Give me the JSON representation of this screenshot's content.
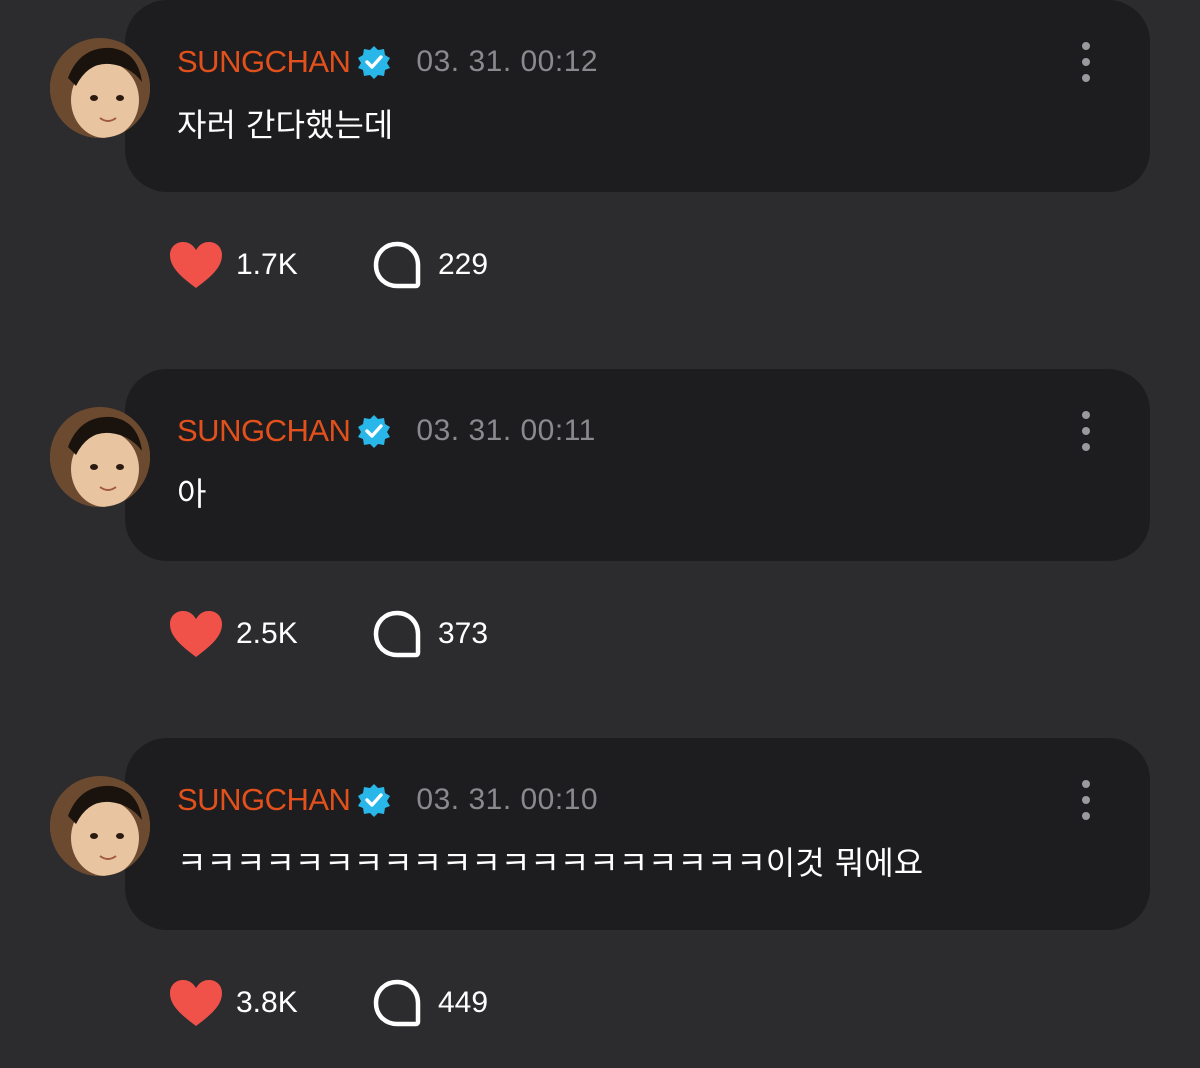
{
  "colors": {
    "background": "#2c2c2e",
    "card": "#1d1d1f",
    "username": "#e2501c",
    "verified": "#29b6e8",
    "heart": "#f0524a",
    "timestamp": "#8a8a8e"
  },
  "posts": [
    {
      "username": "SUNGCHAN",
      "timestamp": "03. 31. 00:12",
      "message": "자러 간다했는데",
      "likes": "1.7K",
      "comments": "229",
      "icons": [
        "avatar",
        "verified-badge-icon",
        "more-options-icon",
        "heart-icon",
        "comment-bubble-icon"
      ]
    },
    {
      "username": "SUNGCHAN",
      "timestamp": "03. 31. 00:11",
      "message": "아",
      "likes": "2.5K",
      "comments": "373",
      "icons": [
        "avatar",
        "verified-badge-icon",
        "more-options-icon",
        "heart-icon",
        "comment-bubble-icon"
      ]
    },
    {
      "username": "SUNGCHAN",
      "timestamp": "03. 31. 00:10",
      "message": "ㅋㅋㅋㅋㅋㅋㅋㅋㅋㅋㅋㅋㅋㅋㅋㅋㅋㅋㅋㅋ이것 뭐에요",
      "likes": "3.8K",
      "comments": "449",
      "icons": [
        "avatar",
        "verified-badge-icon",
        "more-options-icon",
        "heart-icon",
        "comment-bubble-icon"
      ]
    }
  ]
}
